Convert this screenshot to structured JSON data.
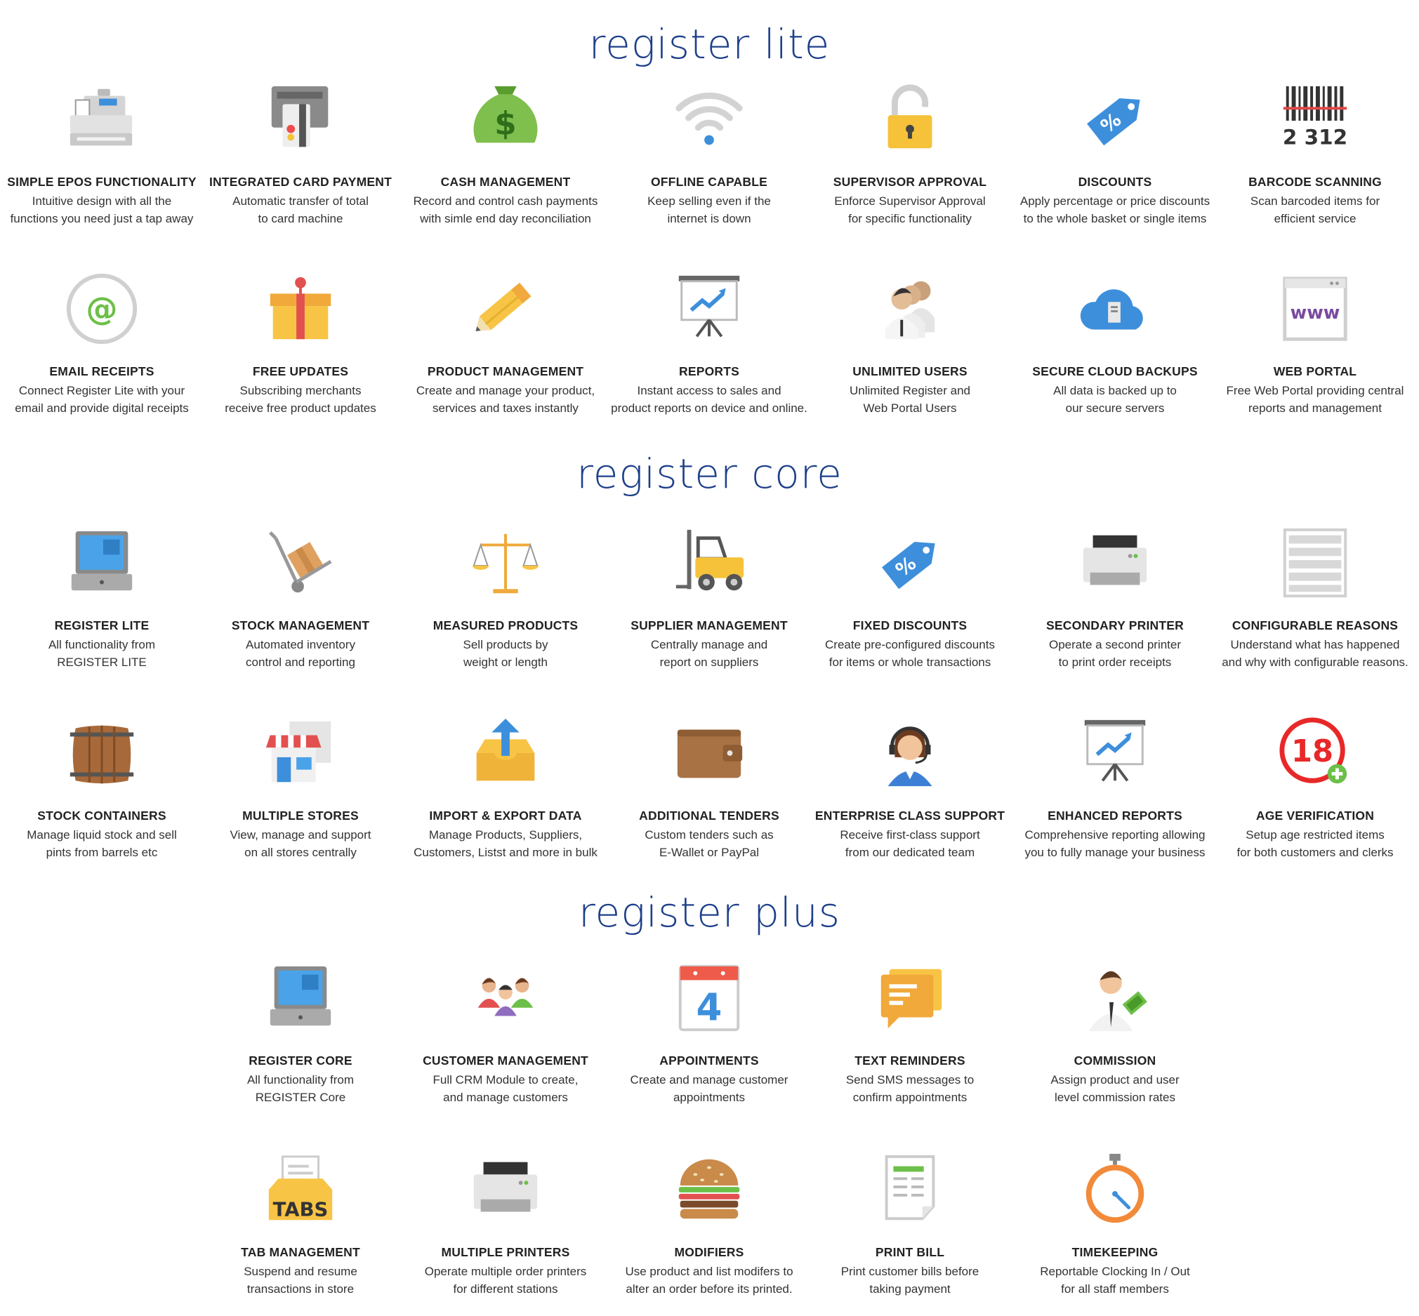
{
  "colors": {
    "heading": "#1d3f8a",
    "title": "#222222",
    "description": "#333333"
  },
  "sections": [
    {
      "title": "register lite",
      "features": [
        {
          "icon": "cash-register-icon",
          "title": "SIMPLE EPOS FUNCTIONALITY",
          "desc": [
            "Intuitive design with all the",
            "functions you need just a tap away"
          ]
        },
        {
          "icon": "card-terminal-icon",
          "title": "INTEGRATED CARD PAYMENT",
          "desc": [
            "Automatic transfer of total",
            "to card machine"
          ]
        },
        {
          "icon": "money-bag-icon",
          "title": "CASH MANAGEMENT",
          "desc": [
            "Record and control cash payments",
            "with simle end day reconciliation"
          ]
        },
        {
          "icon": "wifi-icon",
          "title": "OFFLINE CAPABLE",
          "desc": [
            "Keep selling even if the",
            "internet is down"
          ]
        },
        {
          "icon": "padlock-icon",
          "title": "SUPERVISOR APPROVAL",
          "desc": [
            "Enforce Supervisor Approval",
            "for specific functionality"
          ]
        },
        {
          "icon": "discount-tag-icon",
          "title": "DISCOUNTS",
          "desc": [
            "Apply percentage or price discounts",
            "to the whole basket or single items"
          ]
        },
        {
          "icon": "barcode-icon",
          "title": "BARCODE SCANNING",
          "desc": [
            "Scan barcoded items for",
            "efficient service"
          ],
          "icon_text": "2 312"
        },
        {
          "icon": "email-at-icon",
          "title": "EMAIL RECEIPTS",
          "desc": [
            "Connect Register Lite with your",
            "email and provide digital receipts"
          ]
        },
        {
          "icon": "gift-box-icon",
          "title": "FREE UPDATES",
          "desc": [
            "Subscribing merchants",
            "receive free product updates"
          ]
        },
        {
          "icon": "pencil-icon",
          "title": "PRODUCT MANAGEMENT",
          "desc": [
            "Create and manage your product,",
            "services and taxes instantly"
          ]
        },
        {
          "icon": "presentation-chart-icon",
          "title": "REPORTS",
          "desc": [
            "Instant access to sales and",
            "product reports on device and online."
          ]
        },
        {
          "icon": "users-group-icon",
          "title": "UNLIMITED USERS",
          "desc": [
            "Unlimited Register and",
            "Web Portal Users"
          ]
        },
        {
          "icon": "cloud-server-icon",
          "title": "SECURE CLOUD BACKUPS",
          "desc": [
            "All data is backed up to",
            "our secure servers"
          ]
        },
        {
          "icon": "browser-www-icon",
          "title": "WEB PORTAL",
          "desc": [
            "Free Web Portal providing central",
            "reports and management"
          ],
          "icon_text": "www"
        }
      ]
    },
    {
      "title": "register core",
      "features": [
        {
          "icon": "pos-terminal-icon",
          "title": "REGISTER LITE",
          "desc": [
            "All functionality from",
            "REGISTER LITE"
          ]
        },
        {
          "icon": "hand-truck-icon",
          "title": "STOCK MANAGEMENT",
          "desc": [
            "Automated inventory",
            "control and reporting"
          ]
        },
        {
          "icon": "scales-icon",
          "title": "MEASURED PRODUCTS",
          "desc": [
            "Sell products by",
            "weight or length"
          ]
        },
        {
          "icon": "forklift-icon",
          "title": "SUPPLIER MANAGEMENT",
          "desc": [
            "Centrally manage and",
            "report on suppliers"
          ]
        },
        {
          "icon": "discount-tag-icon",
          "title": "FIXED DISCOUNTS",
          "desc": [
            "Create pre-configured discounts",
            "for items or whole transactions"
          ]
        },
        {
          "icon": "printer-icon",
          "title": "SECONDARY PRINTER",
          "desc": [
            "Operate a second printer",
            "to print order receipts"
          ]
        },
        {
          "icon": "list-panel-icon",
          "title": "CONFIGURABLE REASONS",
          "desc": [
            "Understand what has happened",
            "and why with configurable reasons."
          ]
        },
        {
          "icon": "barrel-icon",
          "title": "STOCK CONTAINERS",
          "desc": [
            "Manage liquid stock and sell",
            "pints from barrels etc"
          ]
        },
        {
          "icon": "stores-icon",
          "title": "MULTIPLE STORES",
          "desc": [
            "View, manage and support",
            "on all stores centrally"
          ]
        },
        {
          "icon": "upload-tray-icon",
          "title": "IMPORT & EXPORT DATA",
          "desc": [
            "Manage Products, Suppliers,",
            "Customers, Listst and more in bulk"
          ]
        },
        {
          "icon": "wallet-icon",
          "title": "ADDITIONAL TENDERS",
          "desc": [
            "Custom tenders such as",
            "E-Wallet or PayPal"
          ]
        },
        {
          "icon": "support-agent-icon",
          "title": "ENTERPRISE CLASS SUPPORT",
          "desc": [
            "Receive first-class support",
            "from our dedicated team"
          ]
        },
        {
          "icon": "presentation-chart-icon",
          "title": "ENHANCED REPORTS",
          "desc": [
            "Comprehensive reporting allowing",
            "you to fully manage your business"
          ]
        },
        {
          "icon": "age-18-icon",
          "title": "AGE VERIFICATION",
          "desc": [
            "Setup age restricted items",
            "for both customers and clerks"
          ],
          "icon_text": "18"
        }
      ]
    },
    {
      "title": "register plus",
      "features": [
        {
          "icon": "pos-terminal-icon",
          "title": "REGISTER CORE",
          "desc": [
            "All functionality from",
            "REGISTER Core"
          ]
        },
        {
          "icon": "customers-icon",
          "title": "CUSTOMER MANAGEMENT",
          "desc": [
            "Full CRM Module to create,",
            "and manage customers"
          ]
        },
        {
          "icon": "calendar-icon",
          "title": "APPOINTMENTS",
          "desc": [
            "Create and manage customer",
            "appointments"
          ],
          "icon_text": "4"
        },
        {
          "icon": "chat-bubble-icon",
          "title": "TEXT REMINDERS",
          "desc": [
            "Send SMS messages to",
            "confirm appointments"
          ]
        },
        {
          "icon": "businessman-money-icon",
          "title": "COMMISSION",
          "desc": [
            "Assign product and user",
            "level commission rates"
          ]
        },
        {
          "icon": "tabs-tray-icon",
          "title": "TAB MANAGEMENT",
          "desc": [
            "Suspend and resume",
            "transactions in store"
          ],
          "icon_text": "TABS"
        },
        {
          "icon": "printer-icon",
          "title": "MULTIPLE PRINTERS",
          "desc": [
            "Operate multiple order printers",
            "for different stations"
          ]
        },
        {
          "icon": "burger-icon",
          "title": "MODIFIERS",
          "desc": [
            "Use product and list modifers to",
            "alter an order before its printed."
          ]
        },
        {
          "icon": "bill-receipt-icon",
          "title": "PRINT BILL",
          "desc": [
            "Print customer bills before",
            "taking payment"
          ]
        },
        {
          "icon": "stopwatch-icon",
          "title": "TIMEKEEPING",
          "desc": [
            "Reportable Clocking In / Out",
            "for all staff members"
          ]
        }
      ]
    }
  ]
}
